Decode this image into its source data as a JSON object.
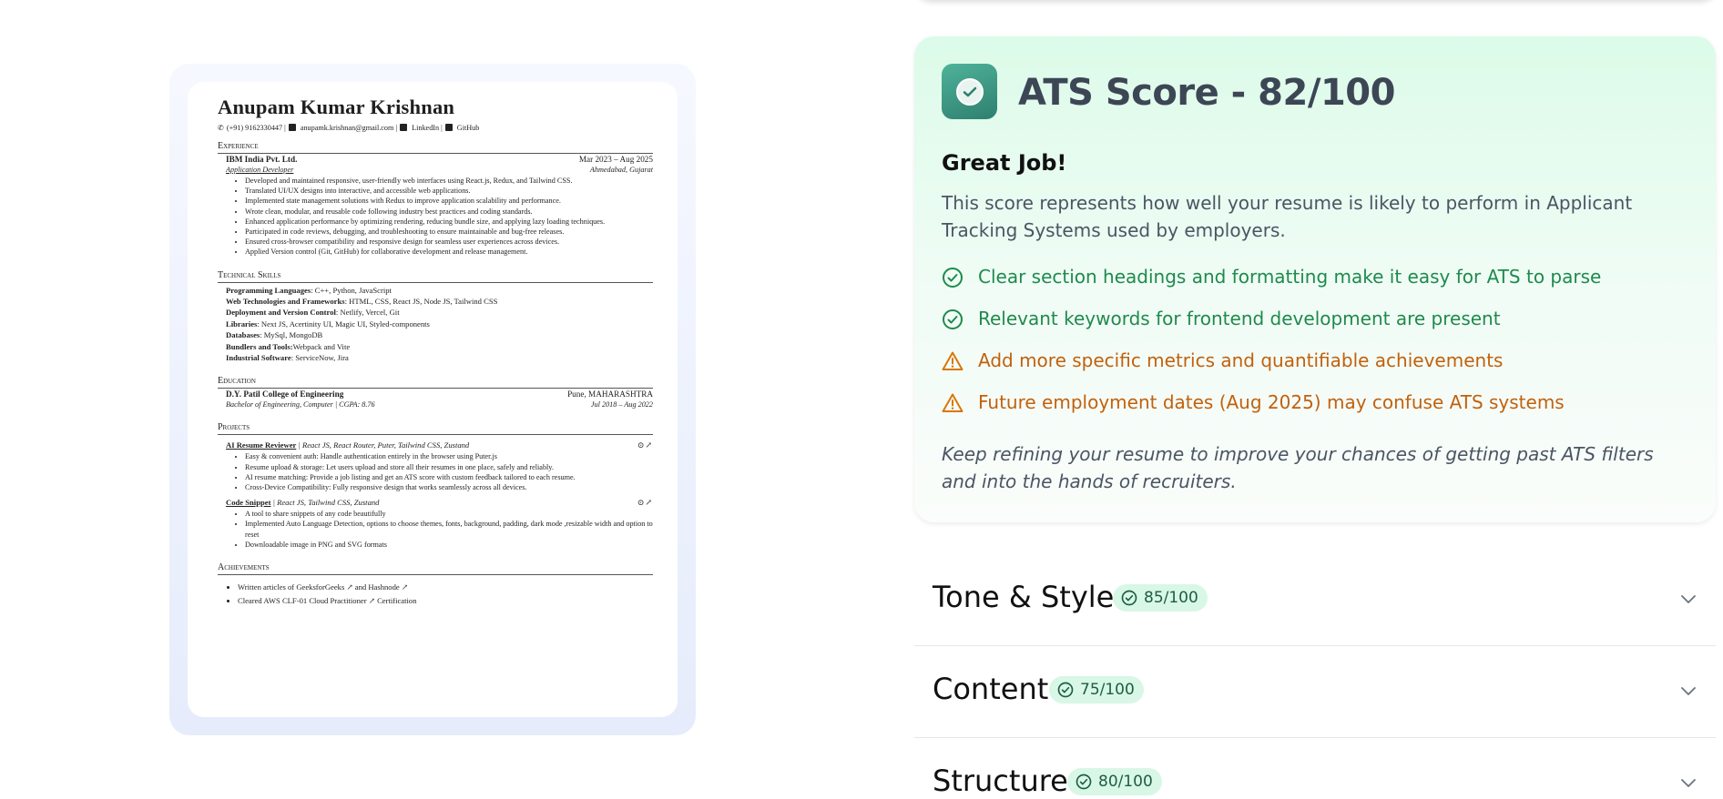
{
  "resume": {
    "name": "Anupam Kumar Krishnan",
    "contact": {
      "phone": "(+91) 9162330447 |",
      "email": "anupamk.krishnan@gmail.com |",
      "linkedin": "LinkedIn |",
      "github": "GitHub"
    },
    "sections": {
      "experience": "Experience",
      "skills": "Technical Skills",
      "education": "Education",
      "projects": "Projects",
      "achievements": "Achievements"
    },
    "job": {
      "company": "IBM India Pvt. Ltd.",
      "dates": "Mar 2023 – Aug 2025",
      "role": "Application Developer",
      "location": "Ahmedabad, Gujarat",
      "bullets": [
        "Developed and maintained responsive, user-friendly web interfaces using React.js, Redux, and Tailwind CSS.",
        "Translated UI/UX designs into interactive, and accessible web applications.",
        "Implemented state management solutions with Redux to improve application scalability and performance.",
        "Wrote clean, modular, and reusable code following industry best practices and coding standards.",
        "Enhanced application performance by optimizing rendering, reducing bundle size, and applying lazy loading techniques.",
        "Participated in code reviews, debugging, and troubleshooting to ensure maintainable and bug-free releases.",
        "Ensured cross-browser compatibility and responsive design for seamless user experiences across devices.",
        "Applied Version control (Git, GitHub) for collaborative development and release management."
      ]
    },
    "skills": [
      {
        "label": "Programming Languages",
        "value": ": C++, Python, JavaScript"
      },
      {
        "label": "Web Technologies and Frameworks",
        "value": ": HTML, CSS, React JS, Node JS, Tailwind CSS"
      },
      {
        "label": "Deployment and Version Control",
        "value": ": Netlify, Vercel, Git"
      },
      {
        "label": "Libraries",
        "value": ": Next JS, Acertinity UI, Magic UI, Styled-components"
      },
      {
        "label": "Databases",
        "value": ": MySql, MongoDB"
      },
      {
        "label": "Bundlers and Tools:",
        "value": "Webpack and Vite"
      },
      {
        "label": "Industrial Software",
        "value": ": ServiceNow, Jira"
      }
    ],
    "education": {
      "school": "D.Y. Patil College of Engineering",
      "location": "Pune, MAHARASHTRA",
      "degree": "Bachelor of Engineering, Computer | CGPA: 8.76",
      "dates": "Jul 2018 – Aug 2022"
    },
    "projects": [
      {
        "title": "AI Resume Reviewer",
        "stack": " | React JS, React Router, Puter, Tailwind CSS, Zustand",
        "bullets": [
          "Easy & convenient auth: Handle authentication entirely in the browser using Puter.js",
          "Resume upload & storage: Let users upload and store all their resumes in one place, safely and reliably.",
          "AI resume matching: Provide a job listing and get an ATS score with custom feedback tailored to each resume.",
          "Cross-Device Compatibility: Fully responsive design that works seamlessly across all devices."
        ]
      },
      {
        "title": "Code Snippet",
        "stack": " | React JS, Tailwind CSS, Zustand",
        "bullets": [
          "A tool to share snippets of any code beautifully",
          "Implemented Auto Language Detection, options to choose themes, fonts, background, padding, dark mode ,resizable width and option to reset",
          "Downloadable image in PNG and SVG formats"
        ]
      }
    ],
    "achievements": [
      "Written articles of GeeksforGeeks ↗ and Hashnode ↗",
      "Cleared AWS CLF-01 Cloud Practitioner ↗ Certification"
    ]
  },
  "ats": {
    "title": "ATS Score - 82/100",
    "subtitle": "Great Job!",
    "description": "This score represents how well your resume is likely to perform in Applicant Tracking Systems used by employers.",
    "tips": [
      {
        "type": "good",
        "text": "Clear section headings and formatting make it easy for ATS to parse"
      },
      {
        "type": "good",
        "text": "Relevant keywords for frontend development are present"
      },
      {
        "type": "warn",
        "text": "Add more specific metrics and quantifiable achievements"
      },
      {
        "type": "warn",
        "text": "Future employment dates (Aug 2025) may confuse ATS systems"
      }
    ],
    "footer": "Keep refining your resume to improve your chances of getting past ATS filters and into the hands of recruiters.",
    "colors": {
      "good": "#1f8a4c",
      "warn": "#c2610c",
      "badge": "#3a9a84"
    }
  },
  "sections": [
    {
      "title": "Tone & Style",
      "score": "85/100"
    },
    {
      "title": "Content",
      "score": "75/100"
    },
    {
      "title": "Structure",
      "score": "80/100"
    }
  ]
}
